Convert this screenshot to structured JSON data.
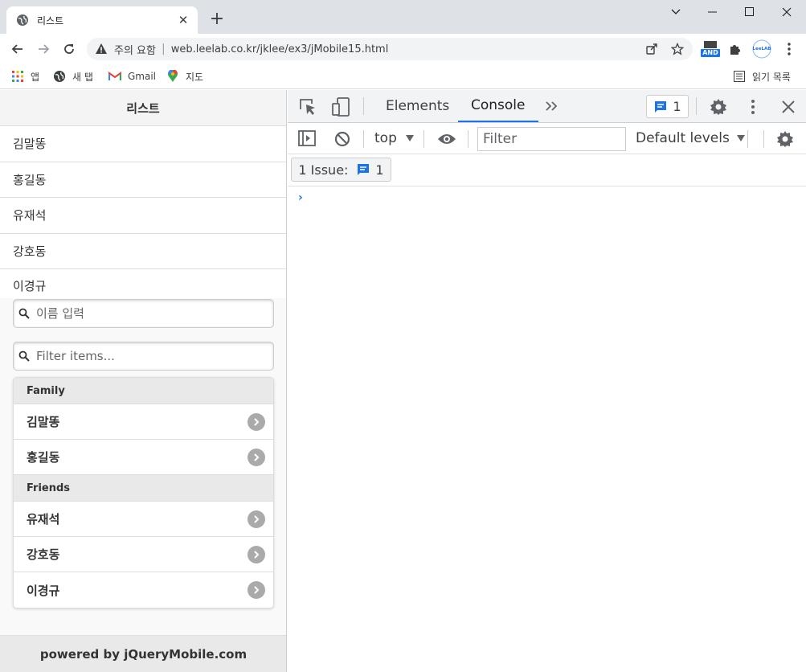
{
  "browser": {
    "tab_title": "리스트",
    "address": {
      "security_text": "주의 요함",
      "url": "web.leelab.co.kr/jklee/ex3/jMobile15.html"
    },
    "extensions": {
      "and_badge": "AND",
      "leelab_label": "LeeLAB"
    },
    "bookmarks": [
      {
        "label": "앱",
        "icon": "apps-grid-icon"
      },
      {
        "label": "새 탭",
        "icon": "globe-icon"
      },
      {
        "label": "Gmail",
        "icon": "gmail-icon"
      },
      {
        "label": "지도",
        "icon": "maps-pin-icon"
      }
    ],
    "reading_list": "읽기 목록"
  },
  "page": {
    "header_title": "리스트",
    "simple_list": [
      "김말똥",
      "홍길동",
      "유재석",
      "강호동",
      "이경규"
    ],
    "name_search_placeholder": "이름 입력",
    "filter_placeholder": "Filter items...",
    "groups": [
      {
        "divider": "Family",
        "items": [
          "김말똥",
          "홍길동"
        ]
      },
      {
        "divider": "Friends",
        "items": [
          "유재석",
          "강호동",
          "이경규"
        ]
      }
    ],
    "footer_text": "powered by jQueryMobile.com"
  },
  "devtools": {
    "tabs": [
      "Elements",
      "Console"
    ],
    "active_tab": "Console",
    "issue_count": "1",
    "context": "top",
    "filter_placeholder": "Filter",
    "levels": "Default levels",
    "issues_label": "1 Issue:",
    "issues_count": "1",
    "prompt_symbol": "›",
    "accent_color": "#1a73e8"
  }
}
